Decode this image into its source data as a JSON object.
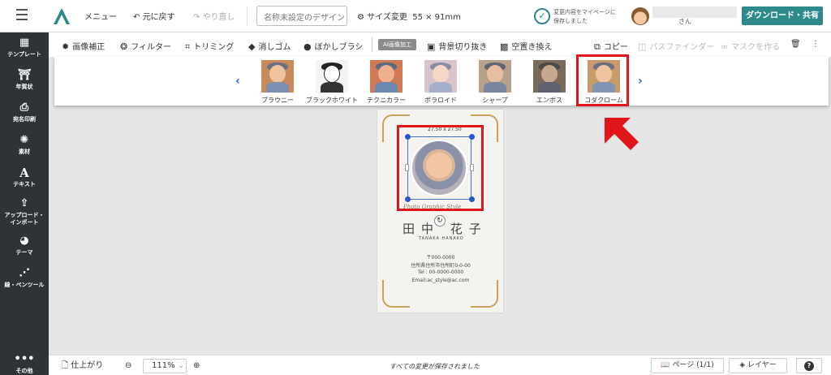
{
  "topbar": {
    "menu": "メニュー",
    "undo": "元に戻す",
    "redo": "やり直し",
    "design_title": "名称未設定のデザイン",
    "size_change_label": "サイズ変更",
    "size_value": "55 × 91mm",
    "saved_line1": "変更内容をマイページに",
    "saved_line2": "保存しました",
    "user_suffix": "さん",
    "download_share": "ダウンロード・共有"
  },
  "sidebar": {
    "items": [
      {
        "label": "テンプレート",
        "icon": "template-icon"
      },
      {
        "label": "年賀状",
        "icon": "newyear-card-icon"
      },
      {
        "label": "宛名印刷",
        "icon": "print-icon"
      },
      {
        "label": "素材",
        "icon": "material-icon"
      },
      {
        "label": "テキスト",
        "icon": "text-icon"
      },
      {
        "label": "アップロード・インポート",
        "icon": "upload-icon"
      },
      {
        "label": "テーマ",
        "icon": "palette-icon"
      },
      {
        "label": "線・ペンツール",
        "icon": "pen-icon"
      }
    ],
    "more": "その他"
  },
  "toolbar": {
    "image_correction": "画像補正",
    "filter": "フィルター",
    "trimming": "トリミング",
    "eraser": "消しゴム",
    "blur_brush": "ぼかしブラシ",
    "ai_badge": "AI画像加工",
    "bg_remove": "背景切り抜き",
    "sky_replace": "空置き換え",
    "copy": "コピー",
    "pathfinder": "パスファインダー",
    "make_mask": "マスクを作る"
  },
  "filters": {
    "items": [
      {
        "label": "ブラウニー",
        "tone": "#c98a5a"
      },
      {
        "label": "ブラックホワイト",
        "tone": "#f4f4f4"
      },
      {
        "label": "テクニカラー",
        "tone": "#d07a55"
      },
      {
        "label": "ポラロイド",
        "tone": "#c9a8b8"
      },
      {
        "label": "シャープ",
        "tone": "#b7a18a"
      },
      {
        "label": "エンボス",
        "tone": "#7a6a5a"
      },
      {
        "label": "コダクローム",
        "tone": "#c79c6c"
      }
    ],
    "selected": "コダクローム"
  },
  "card": {
    "size_label": "27.50 x 27.50",
    "script": "Photo Graphic Style",
    "name_jp": "田中 花子",
    "name_en": "TANAKA HANAKO",
    "postal": "〒000-0000",
    "address": "住所県住所市住所町0-0-00",
    "tel": "Tel : 00-0000-0000",
    "email": "Email:ac_style@ac.com"
  },
  "statusbar": {
    "finish": "仕上がり",
    "zoom": "111%",
    "saved_all": "すべての変更が保存されました",
    "page": "ページ",
    "page_count": "(1/1)",
    "layer": "レイヤー"
  },
  "colors": {
    "accent": "#2e8a8a",
    "highlight": "#e0161a",
    "sidebar_bg": "#2f3237",
    "handle": "#2b57c8",
    "ornament": "#c9a15a"
  }
}
